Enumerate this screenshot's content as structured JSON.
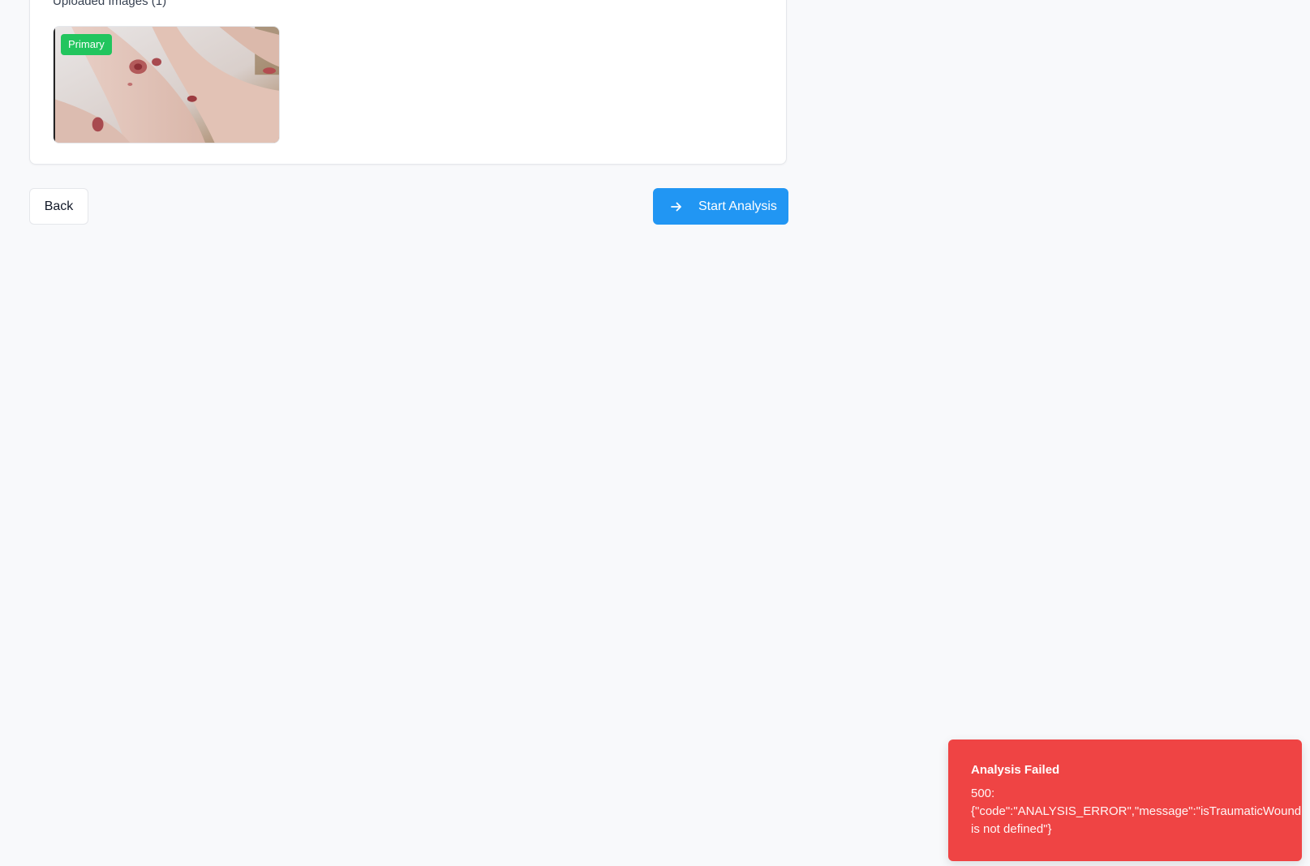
{
  "upload_section": {
    "heading": "Uploaded Images (1)",
    "images": [
      {
        "badge": "Primary",
        "alt": "Uploaded wound image"
      }
    ]
  },
  "actions": {
    "back_label": "Back",
    "start_label": "Start Analysis",
    "start_icon": "arrow-right-icon"
  },
  "toast": {
    "title": "Analysis Failed",
    "message": "500: {\"code\":\"ANALYSIS_ERROR\",\"message\":\"isTraumaticWound is not defined\"}"
  },
  "colors": {
    "background": "#f8f9fb",
    "primary_button": "#2196f3",
    "badge": "#22c55e",
    "toast_error": "#ef4444"
  }
}
